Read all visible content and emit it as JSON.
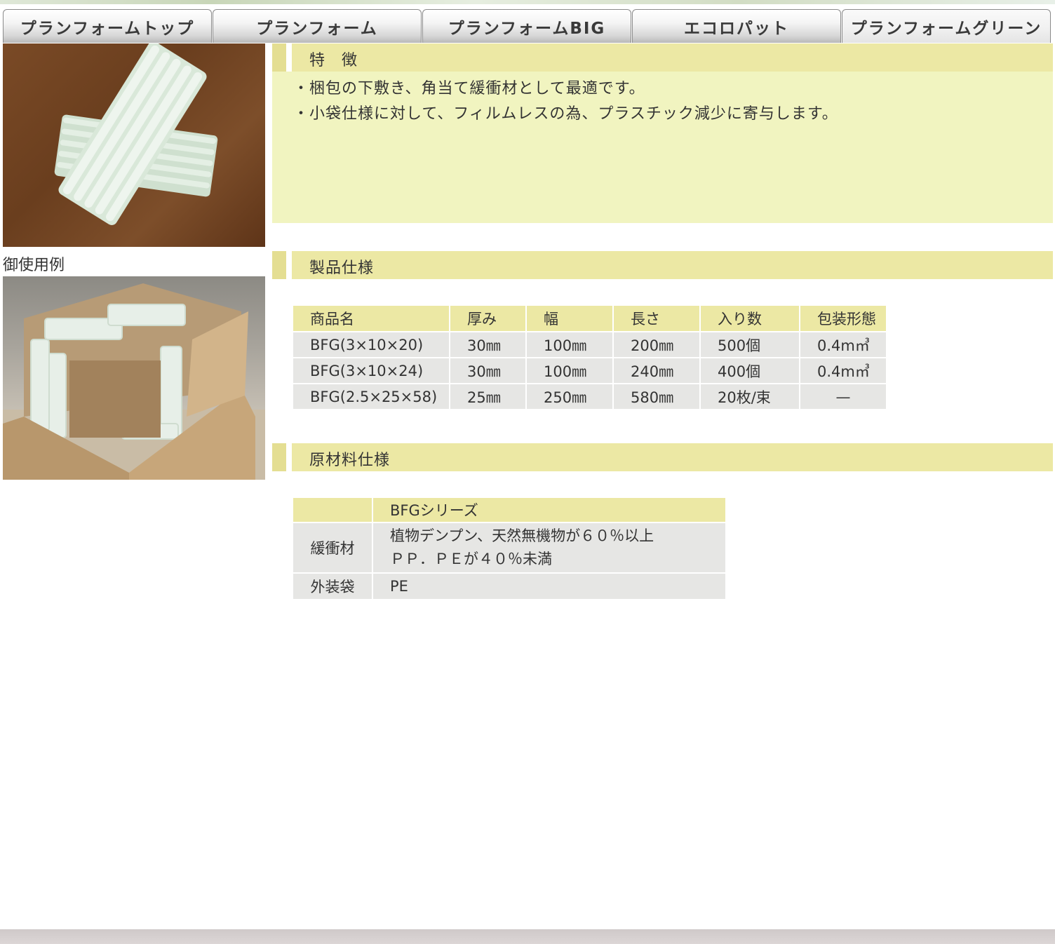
{
  "nav": {
    "tabs": [
      {
        "label": "プランフォームトップ"
      },
      {
        "label": "プランフォーム"
      },
      {
        "label": "プランフォームBIG"
      },
      {
        "label": "エコロパット"
      },
      {
        "label": "プランフォームグリーン",
        "active": true
      }
    ]
  },
  "images": {
    "usage_caption": "御使用例"
  },
  "features": {
    "title": "特　徴",
    "lines": [
      "・梱包の下敷き、角当て緩衝材として最適です。",
      "・小袋仕様に対して、フィルムレスの為、プラスチック減少に寄与します。"
    ]
  },
  "spec": {
    "title": "製品仕様",
    "headers": [
      "商品名",
      "厚み",
      "幅",
      "長さ",
      "入り数",
      "包装形態"
    ],
    "rows": [
      [
        "BFG(3×10×20)",
        "30㎜",
        "100㎜",
        "200㎜",
        "500個",
        "0.4m㎥"
      ],
      [
        "BFG(3×10×24)",
        "30㎜",
        "100㎜",
        "240㎜",
        "400個",
        "0.4m㎥"
      ],
      [
        "BFG(2.5×25×58)",
        "25㎜",
        "250㎜",
        "580㎜",
        "20枚/束",
        "—"
      ]
    ]
  },
  "material": {
    "title": "原材料仕様",
    "header": "BFGシリーズ",
    "rows": [
      {
        "label": "緩衝材",
        "line1": "植物デンプン、天然無機物が６０％以上",
        "line2": "ＰＰ．ＰＥが４０％未満"
      },
      {
        "label": "外装袋",
        "line1": "PE",
        "line2": ""
      }
    ]
  }
}
